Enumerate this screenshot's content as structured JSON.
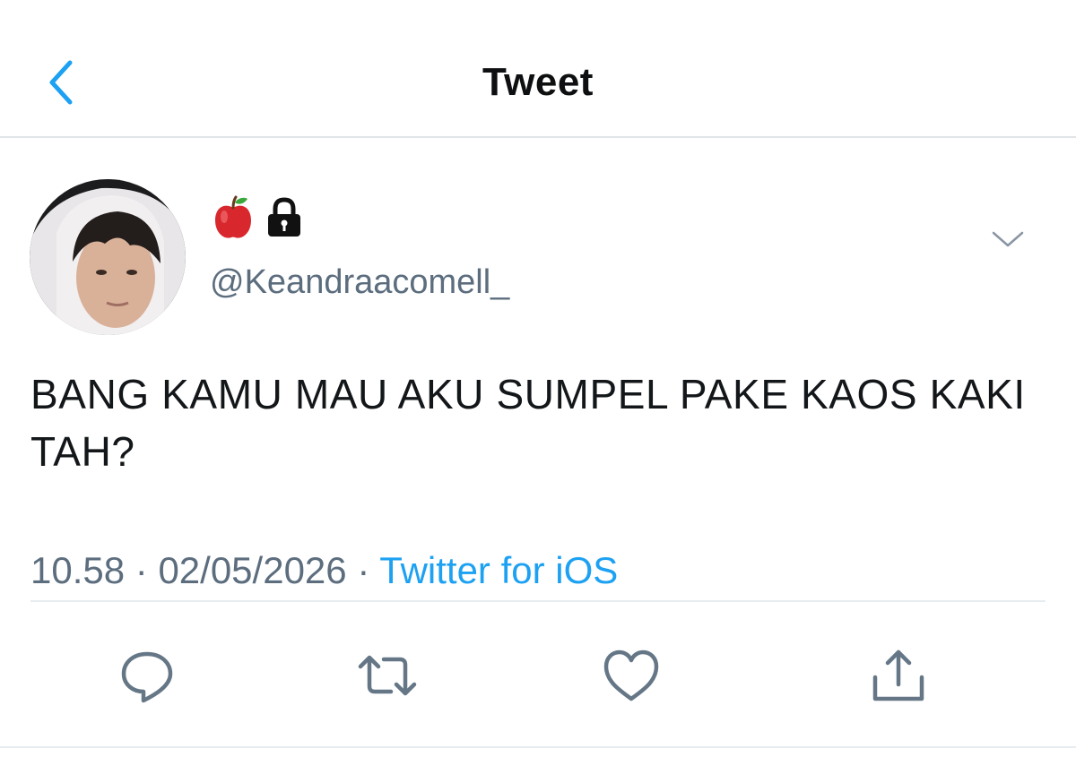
{
  "header": {
    "title": "Tweet",
    "back_icon": "chevron-left-icon"
  },
  "author": {
    "display_name_icons": [
      "red-apple-icon",
      "lock-icon"
    ],
    "handle": "@Keandraacomell_"
  },
  "tweet": {
    "text": "BANG KAMU MAU AKU SUMPEL PAKE KAOS KAKI TAH?",
    "time": "10.58",
    "separator": " · ",
    "date": "02/05/2026",
    "source": "Twitter for iOS"
  },
  "actions": [
    "reply-icon",
    "retweet-icon",
    "like-icon",
    "share-icon"
  ],
  "colors": {
    "accent": "#1da1f2",
    "muted_text": "#5c6d7e",
    "icon_gray": "#657786",
    "divider": "#e6ecf0",
    "apple_red": "#d8282d",
    "text": "#14171a"
  }
}
